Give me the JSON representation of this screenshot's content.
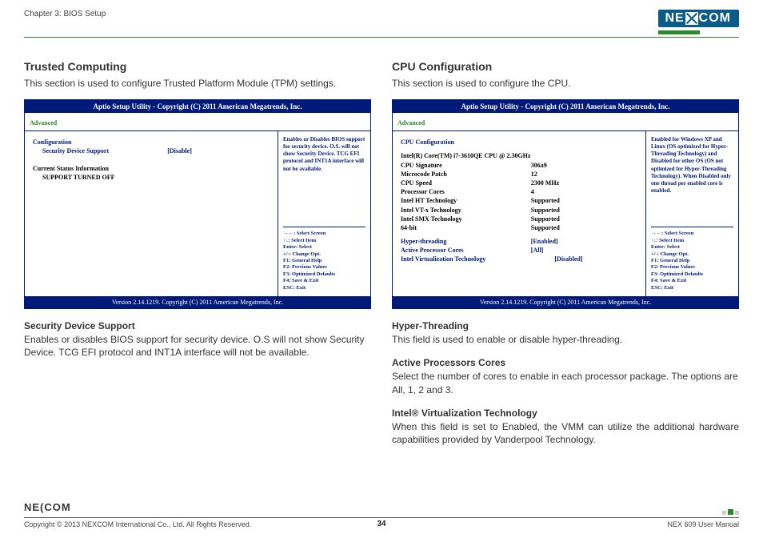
{
  "header": {
    "chapter": "Chapter 3: BIOS Setup",
    "logo_text": "NE COM"
  },
  "left": {
    "title": "Trusted Computing",
    "subtitle": "This section is used to configure Trusted Platform Module (TPM) settings.",
    "bios": {
      "header": "Aptio Setup Utility - Copyright (C) 2011 American Megatrends, Inc.",
      "tab": "Advanced",
      "cfg_label": "Configuration",
      "sds_label": "Security Device Support",
      "sds_value": "[Disable]",
      "csi_label": "Current Status Information",
      "off_label": "SUPPORT TURNED OFF",
      "help": "Enables or Disables BIOS support for security device. O.S. will not show Security Device. TCG EFI protocol and INT1A interface will not be available.",
      "keys": {
        "k1": "→←: Select Screen",
        "k2": "↑↓: Select Item",
        "k3": "Enter: Select",
        "k4": "+/-: Change Opt.",
        "k5": "F1: General Help",
        "k6": "F2: Previous Values",
        "k7": "F3: Optimized Defaults",
        "k8": "F4: Save & Exit",
        "k9": "ESC: Exit"
      },
      "footer": "Version 2.14.1219. Copyright (C) 2011 American Megatrends, Inc."
    },
    "desc1_title": "Security Device Support",
    "desc1_body": "Enables or disables BIOS support for security device. O.S will not show Security Device. TCG EFI protocol and INT1A interface will not be available."
  },
  "right": {
    "title": "CPU Configuration",
    "subtitle": "This section is used to configure the CPU.",
    "bios": {
      "header": "Aptio Setup Utility - Copyright (C) 2011 American Megatrends, Inc.",
      "tab": "Advanced",
      "cfg_label": "CPU Configuration",
      "cpu_name": "Intel(R) Core(TM) i7-3610QE CPU @ 2.30GHz",
      "sig_l": "CPU Signature",
      "sig_v": "306a9",
      "mic_l": "Microcode Patch",
      "mic_v": "12",
      "spd_l": "CPU Speed",
      "spd_v": "2300 MHz",
      "cor_l": "Processor Cores",
      "cor_v": "4",
      "ht_l": "Intel HT Technology",
      "ht_v": "Supported",
      "vt_l": "Intel VT-x Technology",
      "vt_v": "Supported",
      "smx_l": "Intel SMX Technology",
      "smx_v": "Supported",
      "b64_l": "64-bit",
      "b64_v": "Supported",
      "hyp_l": "Hyper-threading",
      "hyp_v": "[Enabled]",
      "apc_l": "Active Processor Cores",
      "apc_v": "[All]",
      "ivt_l": "Intel Virtualization Technology",
      "ivt_v": "[Disabled]",
      "help": "Enabled for Windows XP and Linux (OS optimized for Hyper-Threading Technology) and Disabled for other OS (OS not optimized for Hyper-Threading Technology). When Disabled only one thread per enabled core is enabled.",
      "keys": {
        "k1": "→←: Select Screen",
        "k2": "↑↓: Select Item",
        "k3": "Enter: Select",
        "k4": "+/-: Change Opt.",
        "k5": "F1: General Help",
        "k6": "F2: Previous Values",
        "k7": "F3: Optimized Defaults",
        "k8": "F4: Save & Exit",
        "k9": "ESC: Exit"
      },
      "footer": "Version 2.14.1219. Copyright (C) 2011 American Megatrends, Inc."
    },
    "d1_title": "Hyper-Threading",
    "d1_body": "This field is used to enable or disable hyper-threading.",
    "d2_title": "Active Processors Cores",
    "d2_body": "Select the number of cores to enable in each processor package. The options are All, 1, 2 and 3.",
    "d3_title": "Intel® Virtualization Technology",
    "d3_body": "When this field is set to Enabled, the VMM can utilize the additional hardware capabilities provided by Vanderpool Technology."
  },
  "footer": {
    "copyright": "Copyright © 2013 NEXCOM International Co., Ltd. All Rights Reserved.",
    "page": "34",
    "manual": "NEX 609 User Manual",
    "logo": "NE(COM"
  }
}
